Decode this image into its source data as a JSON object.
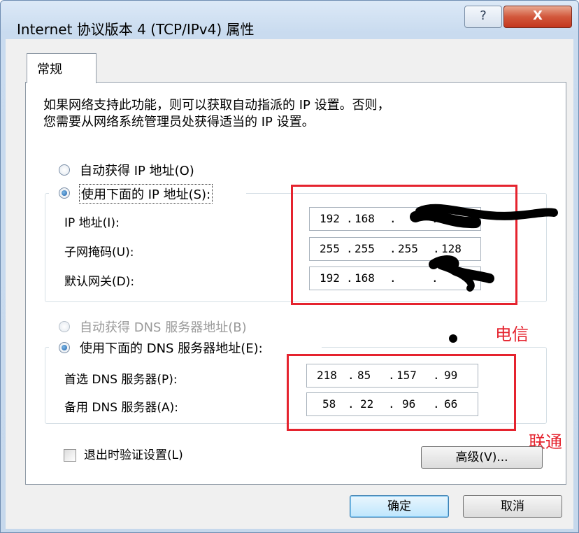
{
  "window": {
    "title": "Internet 协议版本 4 (TCP/IPv4) 属性",
    "help_label": "?",
    "close_label": "X"
  },
  "tab": {
    "label": "常规"
  },
  "description": {
    "line1": "如果网络支持此功能，则可以获取自动指派的 IP 设置。否则，",
    "line2": "您需要从网络系统管理员处获得适当的 IP 设置。"
  },
  "ip_section": {
    "auto_label": "自动获得 IP 地址(O)",
    "manual_label": "使用下面的 IP 地址(S):",
    "selected": "manual",
    "fields": [
      {
        "label": "IP 地址(I):",
        "octets": [
          "192",
          "168",
          "",
          ""
        ]
      },
      {
        "label": "子网掩码(U):",
        "octets": [
          "255",
          "255",
          "255",
          "128"
        ]
      },
      {
        "label": "默认网关(D):",
        "octets": [
          "192",
          "168",
          "",
          ""
        ]
      }
    ]
  },
  "dns_section": {
    "auto_label": "自动获得 DNS 服务器地址(B)",
    "manual_label": "使用下面的 DNS 服务器地址(E):",
    "selected": "manual",
    "fields": [
      {
        "label": "首选 DNS 服务器(P):",
        "octets": [
          "218",
          "85",
          "157",
          "99"
        ]
      },
      {
        "label": "备用 DNS 服务器(A):",
        "octets": [
          "58",
          "22",
          "96",
          "66"
        ]
      }
    ]
  },
  "annotations": {
    "telecom": "电信",
    "unicom": "联通",
    "color": "#e5232e"
  },
  "validate": {
    "label": "退出时验证设置(L)",
    "checked": false
  },
  "buttons": {
    "advanced": "高级(V)...",
    "ok": "确定",
    "cancel": "取消"
  }
}
